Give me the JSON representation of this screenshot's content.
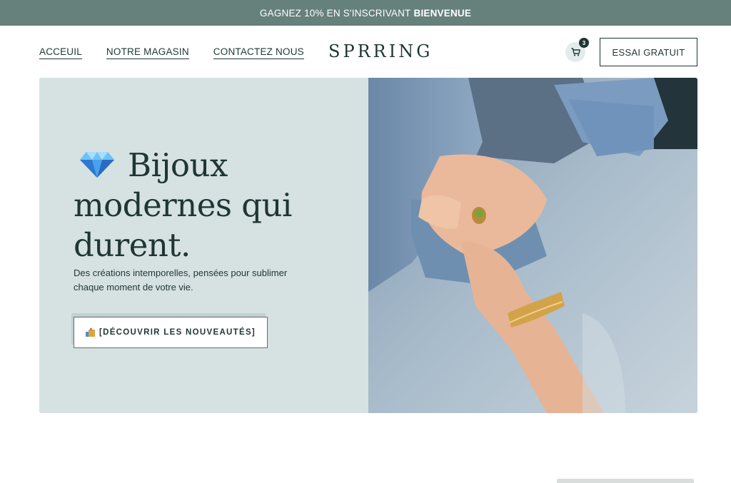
{
  "promo": {
    "text": "GAGNEZ 10% EN S'INSCRIVANT",
    "code": "BIENVENUE"
  },
  "nav": {
    "items": [
      {
        "label": "ACCEUIL"
      },
      {
        "label": "NOTRE MAGASIN"
      },
      {
        "label": "CONTACTEZ NOUS"
      }
    ]
  },
  "brand": {
    "logo": "SPRRING"
  },
  "cart": {
    "count": "3",
    "icon": "cart-icon"
  },
  "header": {
    "trial_label": "ESSAI GRATUIT"
  },
  "hero": {
    "title_line1": "Bijoux",
    "title_line2": "modernes qui",
    "title_line3": "durent.",
    "title_icon": "gem-icon",
    "description": "Des créations intemporelles, pensées pour sublimer chaque moment de votre vie.",
    "cta_label": "[DÉCOUVRIR LES NOUVEAUTÉS]",
    "cta_icon": "shopping-icon"
  },
  "colors": {
    "promo_bg": "#66807c",
    "text": "#1f3633",
    "hero_bg": "#d6e1e2"
  }
}
